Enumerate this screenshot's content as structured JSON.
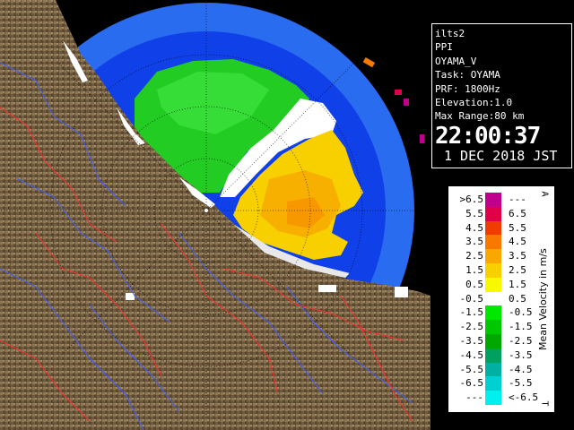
{
  "info": {
    "lines": [
      "ilts2",
      "PPI",
      "OYAMA_V",
      "Task: OYAMA",
      "PRF: 1800Hz",
      "Elevation:1.0",
      "Max Range:80 km"
    ],
    "time": "22:00:37",
    "date": "1 DEC 2018 JST"
  },
  "legend": {
    "title": "Mean Velocity in m/s",
    "mark_top": "A",
    "mark_bottom": "T",
    "rows": [
      {
        "left": ">6.5",
        "right": "---",
        "color": "#c0008c"
      },
      {
        "left": "5.5",
        "right": "6.5",
        "color": "#e0004a"
      },
      {
        "left": "4.5",
        "right": "5.5",
        "color": "#f03c00"
      },
      {
        "left": "3.5",
        "right": "4.5",
        "color": "#f87800"
      },
      {
        "left": "2.5",
        "right": "3.5",
        "color": "#f8a800"
      },
      {
        "left": "1.5",
        "right": "2.5",
        "color": "#f8d000"
      },
      {
        "left": "0.5",
        "right": "1.5",
        "color": "#f8f800"
      },
      {
        "left": "-0.5",
        "right": "0.5",
        "color": "#ffffff"
      },
      {
        "left": "-1.5",
        "right": "-0.5",
        "color": "#00e800"
      },
      {
        "left": "-2.5",
        "right": "-1.5",
        "color": "#00c800"
      },
      {
        "left": "-3.5",
        "right": "-2.5",
        "color": "#00a800"
      },
      {
        "left": "-4.5",
        "right": "-3.5",
        "color": "#00a060"
      },
      {
        "left": "-5.5",
        "right": "-4.5",
        "color": "#00b0a0"
      },
      {
        "left": "-6.5",
        "right": "-5.5",
        "color": "#00d0d0"
      },
      {
        "left": "---",
        "right": "<-6.5",
        "color": "#00f0f0"
      }
    ]
  },
  "colors": {
    "background": "#000000",
    "radar_blue": "#0a4ff0",
    "outer_blue": "#2a6cf0",
    "terrain": "#8a7354",
    "sea_return_green": "#22d522",
    "sea_return_yellow": "#f8d000",
    "sea_return_orange": "#f8a000"
  }
}
